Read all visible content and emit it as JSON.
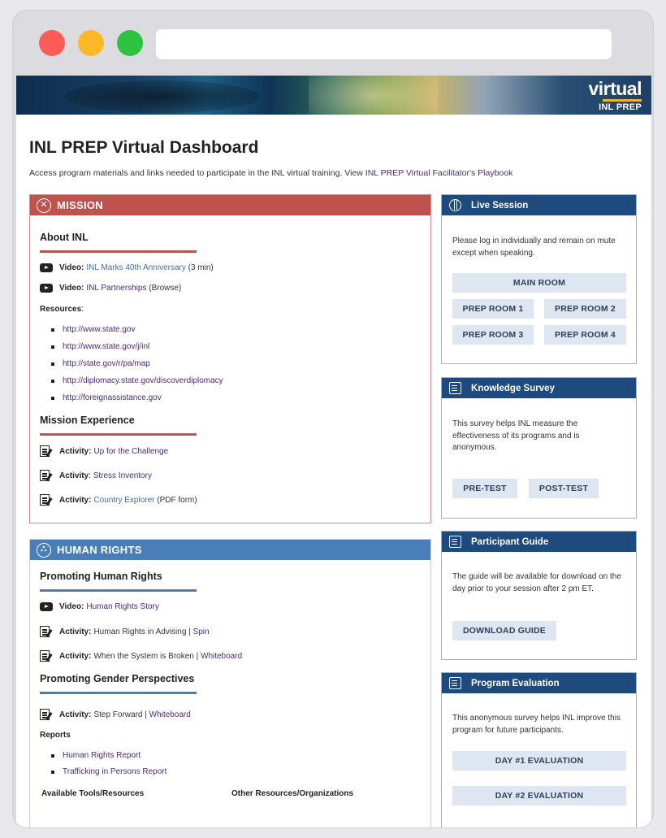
{
  "banner": {
    "logo_word": "virtual",
    "logo_sub": "INL PREP"
  },
  "page": {
    "title": "INL PREP Virtual Dashboard",
    "intro_text": "Access program materials and links needed to participate in the INL virtual training. View ",
    "intro_link": "INL PREP Virtual Facilitator's Playbook"
  },
  "mission": {
    "header": "MISSION",
    "about_title": "About INL",
    "video1": {
      "label": "Video:",
      "link": "INL Marks 40th Anniversary",
      "suffix": "(3 min)"
    },
    "video2": {
      "label": "Video:",
      "link": "INL Partnerships",
      "suffix": "(Browse)"
    },
    "resources_label": "Resources",
    "resources_colon": ":",
    "resources": [
      "http://www.state.gov",
      "http://www.state.gov/j/inl",
      "http://state.gov/r/pa/map",
      "http://diplomacy.state.gov/discoverdiplomacy",
      "http://foreignassistance.gov"
    ],
    "experience_title": "Mission Experience",
    "activity1": {
      "label": "Activity:",
      "link": "Up for the Challenge"
    },
    "activity2": {
      "label": "Activity",
      "sep": ":",
      "link": "Stress Inventory"
    },
    "activity3": {
      "label": "Activity:",
      "link": "Country Explorer",
      "suffix": "(PDF form)"
    }
  },
  "human_rights": {
    "header": "HUMAN RIGHTS",
    "promoting_title": "Promoting Human Rights",
    "video1": {
      "label": "Video:",
      "link": "Human Rights Story"
    },
    "activity1": {
      "label": "Activity:",
      "text": "Human Rights in Advising |",
      "link": "Spin"
    },
    "activity2": {
      "label": "Activity:",
      "text": "When the System is Broken |",
      "link": "Whiteboard"
    },
    "gender_title": "Promoting Gender Perspectives",
    "activity3": {
      "label": "Activity:",
      "text": "Step Forward |",
      "link": "Whiteboard"
    },
    "reports_label": "Reports",
    "reports": [
      "Human Rights Report",
      "Trafficking in Persons Report"
    ],
    "tools_label": "Available Tools/Resources",
    "other_label": "Other Resources/Organizations"
  },
  "live_session": {
    "title": "Live Session",
    "text": "Please log in individually and remain on mute except when speaking.",
    "main_room": "MAIN ROOM",
    "rooms": [
      "PREP ROOM 1",
      "PREP ROOM 2",
      "PREP ROOM 3",
      "PREP ROOM 4"
    ]
  },
  "knowledge_survey": {
    "title": "Knowledge Survey",
    "text": "This survey helps INL measure the effectiveness of its programs and is anonymous.",
    "pre": "PRE-TEST",
    "post": "POST-TEST"
  },
  "participant_guide": {
    "title": "Participant Guide",
    "text": "The guide will be available for download on the day prior to your session after 2 pm ET.",
    "button": "DOWNLOAD GUIDE"
  },
  "program_evaluation": {
    "title": "Program Evaluation",
    "text": "This anonymous survey helps INL improve this program for future participants.",
    "day1": "DAY #1 EVALUATION",
    "day2": "DAY #2 EVALUATION"
  },
  "colors": {
    "mission": "#bf524d",
    "human_rights": "#4a7eb8",
    "card_header": "#1e4a7e",
    "link_purple": "#4b2a7a",
    "link_blue": "#3f6fa7"
  }
}
